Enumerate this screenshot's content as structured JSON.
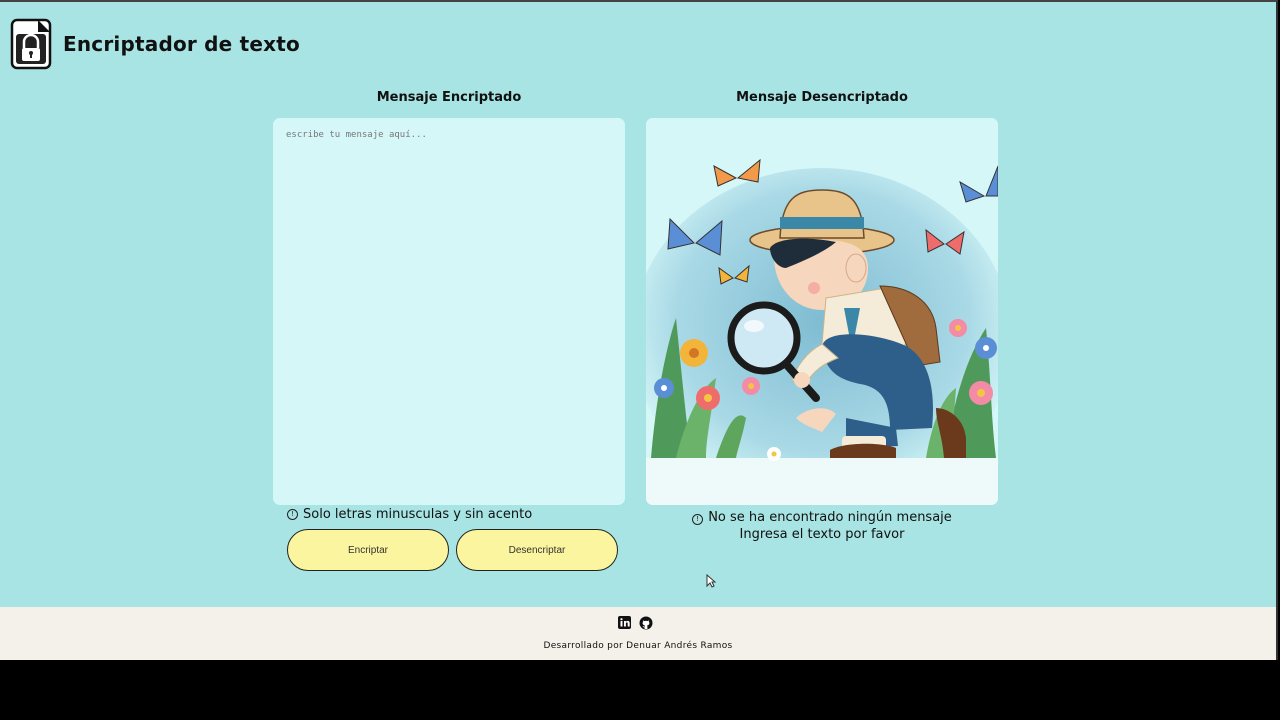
{
  "header": {
    "title": "Encriptador de texto",
    "logo_icon": "lock-document-icon"
  },
  "left": {
    "title": "Mensaje Encriptado",
    "placeholder": "escribe tu mensaje aquí...",
    "value": "",
    "hint": "Solo letras minusculas y sin acento",
    "hint_icon": "info-icon"
  },
  "right": {
    "title": "Mensaje Desencriptado",
    "illustration": "boy-with-magnifying-glass-in-garden",
    "empty_line1": "No se ha encontrado ningún mensaje",
    "empty_line2": "Ingresa el texto por favor"
  },
  "buttons": {
    "encrypt": "Encriptar",
    "decrypt": "Desencriptar"
  },
  "footer": {
    "credit": "Desarrollado por Denuar Andrés Ramos",
    "icons": [
      "linkedin-icon",
      "github-icon"
    ]
  },
  "colors": {
    "background": "#a8e4e4",
    "panel": "#d6f7f8",
    "button": "#fbf59f",
    "footer": "#f3f1ea"
  }
}
